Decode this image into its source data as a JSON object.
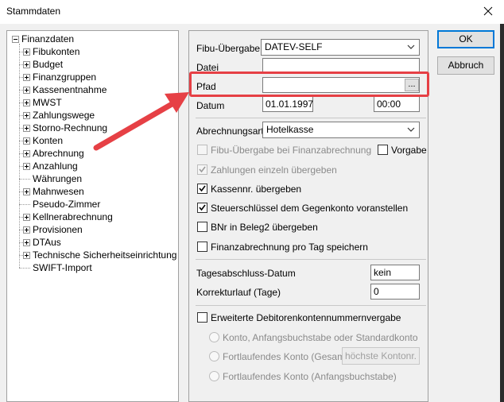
{
  "window": {
    "title": "Stammdaten"
  },
  "tree": {
    "root": "Finanzdaten",
    "items": [
      {
        "label": "Fibukonten",
        "expandable": true
      },
      {
        "label": "Budget",
        "expandable": true
      },
      {
        "label": "Finanzgruppen",
        "expandable": true
      },
      {
        "label": "Kassenentnahme",
        "expandable": true
      },
      {
        "label": "MWST",
        "expandable": true
      },
      {
        "label": "Zahlungswege",
        "expandable": true
      },
      {
        "label": "Storno-Rechnung",
        "expandable": true
      },
      {
        "label": "Konten",
        "expandable": true
      },
      {
        "label": "Abrechnung",
        "expandable": true
      },
      {
        "label": "Anzahlung",
        "expandable": true
      },
      {
        "label": "Währungen",
        "expandable": false
      },
      {
        "label": "Mahnwesen",
        "expandable": true
      },
      {
        "label": "Pseudo-Zimmer",
        "expandable": false
      },
      {
        "label": "Kellnerabrechnung",
        "expandable": true
      },
      {
        "label": "Provisionen",
        "expandable": true
      },
      {
        "label": "DTAus",
        "expandable": true
      },
      {
        "label": "Technische Sicherheitseinrichtung",
        "expandable": true
      },
      {
        "label": "SWIFT-Import",
        "expandable": false
      }
    ]
  },
  "form": {
    "fibu_label": "Fibu-Übergabe",
    "fibu_value": "DATEV-SELF",
    "datei_label": "Datei",
    "datei_value": "",
    "pfad_label": "Pfad",
    "pfad_value": "",
    "pfad_browse": "...",
    "datum_label": "Datum",
    "datum_value": "01.01.1997",
    "time_value": "00:00",
    "abrechnungsart_label": "Abrechnungsart",
    "abrechnungsart_value": "Hotelkasse",
    "cb_fibu_finanz": "Fibu-Übergabe bei Finanzabrechnung",
    "cb_vorgabe": "Vorgabe",
    "cb_zahlungen": "Zahlungen einzeln übergeben",
    "cb_kassennr": "Kassennr. übergeben",
    "cb_steuer": "Steuerschlüssel dem Gegenkonto voranstellen",
    "cb_bnr": "BNr in Beleg2 übergeben",
    "cb_finanz_tag": "Finanzabrechnung pro Tag speichern",
    "tagesabschluss_label": "Tagesabschluss-Datum",
    "tagesabschluss_value": "kein",
    "korrektur_label": "Korrekturlauf (Tage)",
    "korrektur_value": "0",
    "cb_erweiterte": "Erweiterte Debitorenkontennummernvergabe",
    "radio_konto": "Konto, Anfangsbuchstabe oder Standardkonto",
    "radio_fortlaufend_gesamt": "Fortlaufendes Konto (Gesamt)",
    "btn_hoechste": "höchste Kontonr.",
    "radio_fortlaufend_anfang": "Fortlaufendes Konto (Anfangsbuchstabe)"
  },
  "buttons": {
    "ok": "OK",
    "abbruch": "Abbruch"
  },
  "colors": {
    "highlight": "#e64045",
    "default_button_border": "#0078d7"
  }
}
